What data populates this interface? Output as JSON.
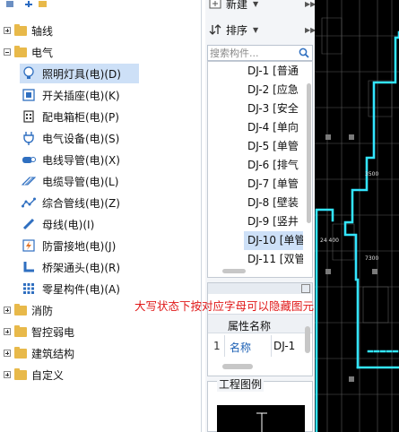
{
  "colors": {
    "selection": "#cde0f7",
    "folder": "#e8b94a",
    "cad_cyan": "#33e5ff",
    "annotation": "#e01919"
  },
  "tree": {
    "categories": [
      {
        "label": "轴线",
        "expanded": false,
        "icon": "folder-icon"
      },
      {
        "label": "电气",
        "expanded": true,
        "icon": "folder-icon"
      },
      {
        "label": "消防",
        "expanded": false,
        "icon": "folder-icon"
      },
      {
        "label": "智控弱电",
        "expanded": false,
        "icon": "folder-icon"
      },
      {
        "label": "建筑结构",
        "expanded": false,
        "icon": "folder-icon"
      },
      {
        "label": "自定义",
        "expanded": false,
        "icon": "folder-icon"
      }
    ],
    "electric_items": [
      {
        "label": "照明灯具(电)(D)",
        "icon": "bulb-icon",
        "selected": true
      },
      {
        "label": "开关插座(电)(K)",
        "icon": "switch-socket-icon",
        "selected": false
      },
      {
        "label": "配电箱柜(电)(P)",
        "icon": "distribution-box-icon",
        "selected": false
      },
      {
        "label": "电气设备(电)(S)",
        "icon": "plug-icon",
        "selected": false
      },
      {
        "label": "电线导管(电)(X)",
        "icon": "wire-conduit-icon",
        "selected": false
      },
      {
        "label": "电缆导管(电)(L)",
        "icon": "cable-conduit-icon",
        "selected": false
      },
      {
        "label": "综合管线(电)(Z)",
        "icon": "pipeline-icon",
        "selected": false
      },
      {
        "label": "母线(电)(I)",
        "icon": "busbar-icon",
        "selected": false
      },
      {
        "label": "防雷接地(电)(J)",
        "icon": "lightning-icon",
        "selected": false
      },
      {
        "label": "桥架通头(电)(R)",
        "icon": "tray-fitting-icon",
        "selected": false
      },
      {
        "label": "零星构件(电)(A)",
        "icon": "grid-icon",
        "selected": false
      }
    ]
  },
  "middle": {
    "new_label": "新建",
    "sort_label": "排序",
    "search_placeholder": "搜索构件...",
    "list_items": [
      {
        "label": "DJ-1 [普通",
        "selected": false
      },
      {
        "label": "DJ-2 [应急",
        "selected": false
      },
      {
        "label": "DJ-3 [安全",
        "selected": false
      },
      {
        "label": "DJ-4 [单向",
        "selected": false
      },
      {
        "label": "DJ-5 [单管",
        "selected": false
      },
      {
        "label": "DJ-6 [排气",
        "selected": false
      },
      {
        "label": "DJ-7 [单管",
        "selected": false
      },
      {
        "label": "DJ-8 [壁装",
        "selected": false
      },
      {
        "label": "DJ-9 [竖井",
        "selected": false
      },
      {
        "label": "DJ-10 [单管",
        "selected": true
      },
      {
        "label": "DJ-11 [双管",
        "selected": false
      }
    ],
    "properties": {
      "column_header": "属性名称",
      "row_number": "1",
      "row_name": "名称",
      "row_value": "DJ-1"
    },
    "legend_title": "工程图例"
  },
  "cad": {
    "labels": [
      "3500",
      "24 400",
      "7300"
    ]
  },
  "annotation": "大写状态下按对应字母可以隐藏图元"
}
